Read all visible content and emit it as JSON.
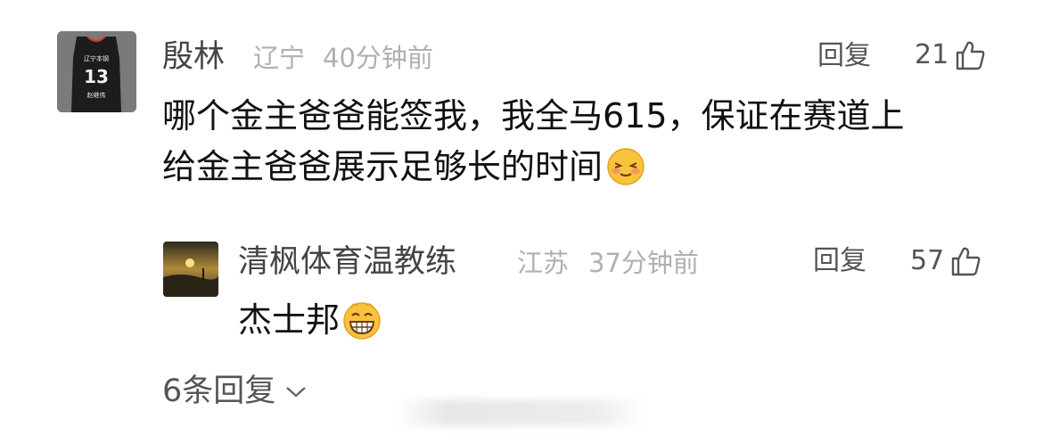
{
  "comment": {
    "author": "殷林",
    "location": "辽宁",
    "time": "40分钟前",
    "reply_label": "回复",
    "likes": "21",
    "text_lines": [
      "哪个金主爸爸能签我，我全马615，保证在赛道上",
      "给金主爸爸展示足够长的时间"
    ],
    "emoji": "shy-smile-emoji",
    "avatar": {
      "jersey_team": "辽宁本钢",
      "jersey_number": "13",
      "jersey_name": "赵继伟"
    }
  },
  "reply": {
    "author": "清枫体育温教练",
    "location": "江苏",
    "time": "37分钟前",
    "reply_label": "回复",
    "likes": "57",
    "text": "杰士邦",
    "emoji": "grin-emoji"
  },
  "more_replies": {
    "label": "6条回复"
  },
  "colors": {
    "name": "#444444",
    "meta": "#b0b0b0",
    "body_text": "#111111",
    "emoji_yellow": "#f9c23c",
    "emoji_blush": "#f38b6b"
  }
}
